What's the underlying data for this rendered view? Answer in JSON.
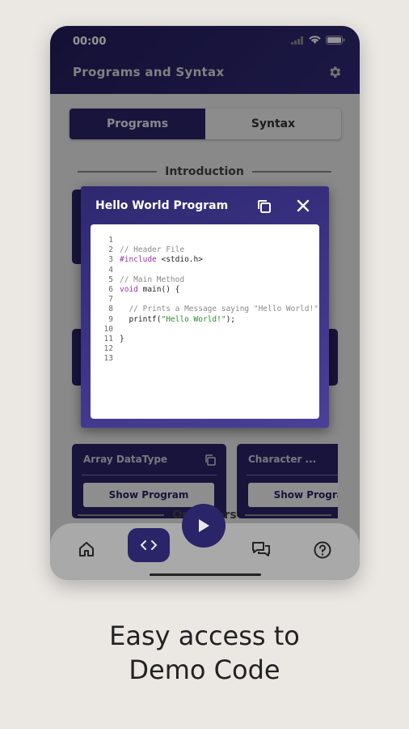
{
  "status": {
    "time": "00:00"
  },
  "appbar": {
    "title": "Programs and Syntax"
  },
  "tabs": [
    {
      "label": "Programs",
      "active": true
    },
    {
      "label": "Syntax",
      "active": false
    }
  ],
  "sections": {
    "introduction": "Introduction",
    "operators": "Operators"
  },
  "cards": [
    {
      "title": "Array DataType",
      "button": "Show Program"
    },
    {
      "title": "Character ...",
      "button": "Show Program"
    }
  ],
  "dialog": {
    "title": "Hello World Program",
    "line_numbers": [
      "1",
      "2",
      "3",
      "4",
      "5",
      "6",
      "7",
      "8",
      "9",
      "10",
      "11",
      "12",
      "13"
    ],
    "code": {
      "l2": "// Header File",
      "l3_kw": "#include",
      "l3_rest": " <stdio.h>",
      "l5": "// Main Method",
      "l6_kw": "void",
      "l6_rest": " main() {",
      "l8": "  // Prints a Message saying \"Hello World!\"",
      "l9_pre": "  printf(",
      "l9_str": "\"Hello World!\"",
      "l9_post": ");",
      "l11": "}"
    }
  },
  "caption": {
    "line1": "Easy access to",
    "line2": "Demo Code"
  },
  "colors": {
    "primary": "#2a2468",
    "dialog_gradient_end": "#4a3f9a",
    "keyword": "#9b2fae",
    "string": "#2e8b2e",
    "comment": "#8a8a8a"
  }
}
